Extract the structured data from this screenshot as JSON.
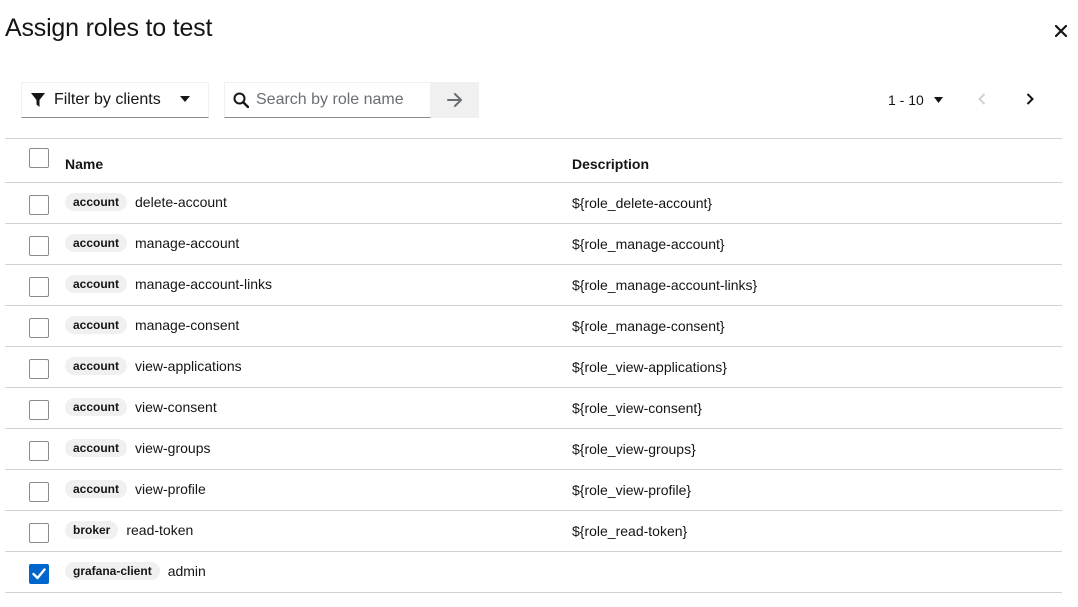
{
  "modal": {
    "title": "Assign roles to test",
    "close_icon": "close-icon"
  },
  "toolbar": {
    "filter_label": "Filter by clients",
    "filter_icon": "filter-icon",
    "search_placeholder": "Search by role name",
    "search_value": "",
    "search_icon": "search-icon",
    "search_submit_icon": "arrow-right-icon"
  },
  "pagination": {
    "range": "1 - 10",
    "prev_icon": "chevron-left-icon",
    "next_icon": "chevron-right-icon"
  },
  "table": {
    "headers": {
      "name": "Name",
      "description": "Description"
    },
    "rows": [
      {
        "client": "account",
        "role": "delete-account",
        "description": "${role_delete-account}",
        "checked": false
      },
      {
        "client": "account",
        "role": "manage-account",
        "description": "${role_manage-account}",
        "checked": false
      },
      {
        "client": "account",
        "role": "manage-account-links",
        "description": "${role_manage-account-links}",
        "checked": false
      },
      {
        "client": "account",
        "role": "manage-consent",
        "description": "${role_manage-consent}",
        "checked": false
      },
      {
        "client": "account",
        "role": "view-applications",
        "description": "${role_view-applications}",
        "checked": false
      },
      {
        "client": "account",
        "role": "view-consent",
        "description": "${role_view-consent}",
        "checked": false
      },
      {
        "client": "account",
        "role": "view-groups",
        "description": "${role_view-groups}",
        "checked": false
      },
      {
        "client": "account",
        "role": "view-profile",
        "description": "${role_view-profile}",
        "checked": false
      },
      {
        "client": "broker",
        "role": "read-token",
        "description": "${role_read-token}",
        "checked": false
      },
      {
        "client": "grafana-client",
        "role": "admin",
        "description": "",
        "checked": true
      }
    ]
  },
  "colors": {
    "accent": "#0066cc",
    "border": "#d2d2d2",
    "badge_bg": "#f0f0f0"
  }
}
